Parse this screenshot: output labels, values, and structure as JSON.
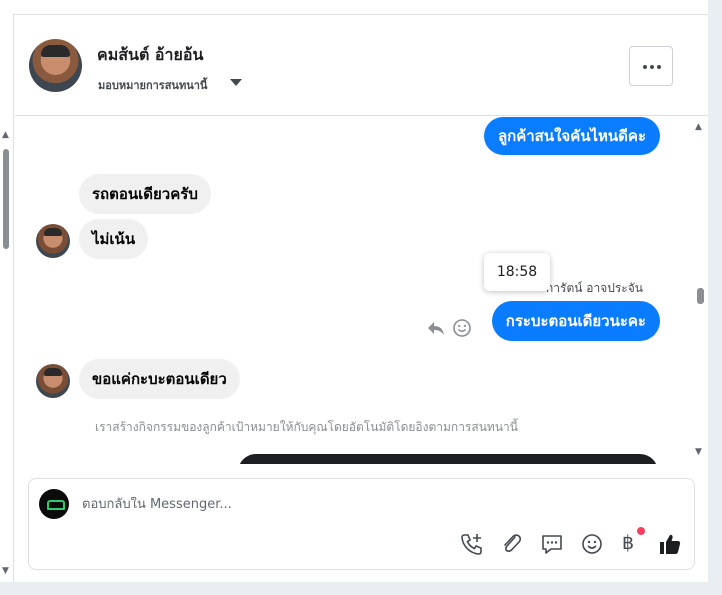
{
  "header": {
    "contact_name": "คมส้นต์ อ้ายอ้น",
    "assign_label": "มอบหมายการสนทนานี้"
  },
  "messages": [
    {
      "direction": "out",
      "text": "ลูกค้าสนใจคันไหนดีคะ"
    },
    {
      "direction": "in",
      "text": "รถตอนเดียวครับ"
    },
    {
      "direction": "in",
      "text": "ไม่เน้น"
    },
    {
      "direction": "out",
      "text": "กระบะตอนเดียวนะคะ",
      "sender": "การัตน์ อาจประจัน",
      "tooltip_time": "18:58"
    },
    {
      "direction": "in",
      "text": "ขอแค่กะบะตอนเดียว"
    }
  ],
  "auto_note": "เราสร้างกิจกรรมของลูกค้าเป้าหมายให้กับคุณโดยอัตโนมัติโดยอิงตามการสนทนานี้",
  "composer": {
    "placeholder": "ตอบกลับใน Messenger...",
    "value": ""
  },
  "tools": {
    "currency_symbol": "฿"
  },
  "colors": {
    "outgoing_bubble": "#0a7cff",
    "incoming_bubble": "#f0f0f0",
    "notification_dot": "#fa3e5e"
  }
}
